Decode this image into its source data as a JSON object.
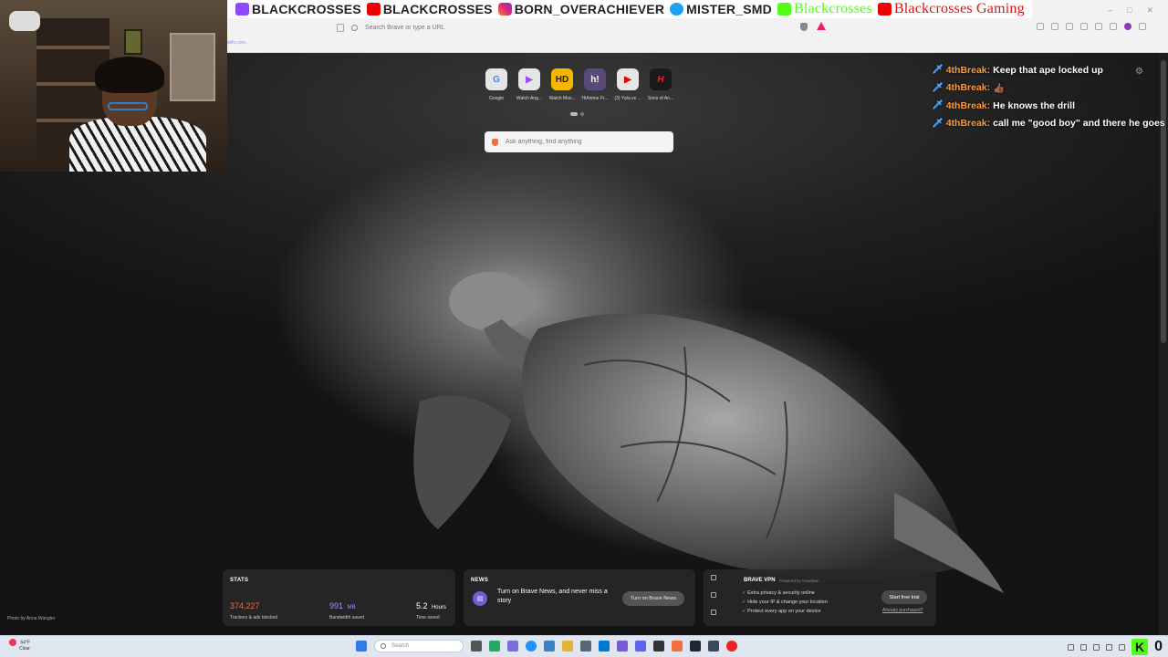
{
  "social": [
    {
      "platform": "twitch",
      "handle": "BLACKCROSSES"
    },
    {
      "platform": "youtube",
      "handle": "BLACKCROSSES"
    },
    {
      "platform": "instagram",
      "handle": "BORN_OVERACHIEVER"
    },
    {
      "platform": "twitter",
      "handle": "MISTER_SMD"
    },
    {
      "platform": "kick",
      "handle": "Blackcrosses"
    },
    {
      "platform": "youtube",
      "handle": "Blackcrosses Gaming"
    }
  ],
  "browser": {
    "address_placeholder": "Search Brave or type a URL",
    "tab_hint": "skfs.com..."
  },
  "quick_links": [
    {
      "icon": "google-icon",
      "caption": "Google",
      "color": "#e6e6e6"
    },
    {
      "icon": "play-icon",
      "caption": "Watch Ang...",
      "color": "#e6e6e6"
    },
    {
      "icon": "hd-icon",
      "caption": "Watch Mov...",
      "label": "HD",
      "color": "#f5b700"
    },
    {
      "icon": "hianime-icon",
      "caption": "HiAnime Fr...",
      "label": "h!",
      "color": "#5a4a7a"
    },
    {
      "icon": "youtube-icon",
      "caption": "(3) Yuta vs ...",
      "color": "#e6e6e6"
    },
    {
      "icon": "h-icon",
      "caption": "Sons of An...",
      "label": "H",
      "color": "#1a1a1a"
    }
  ],
  "search": {
    "placeholder": "Ask anything, find anything"
  },
  "chat": [
    {
      "user": "4thBreak:",
      "text": "Keep that ape locked up"
    },
    {
      "user": "4thBreak:",
      "text": "👍🏾"
    },
    {
      "user": "4thBreak:",
      "text": "He knows the drill"
    },
    {
      "user": "4thBreak:",
      "text": "call me \"good boy\" and there he goes"
    }
  ],
  "stats": {
    "label": "STATS",
    "trackers": {
      "value": "374,227",
      "sub": "Trackers & ads blocked"
    },
    "bandwidth": {
      "value": "991",
      "unit": "MB",
      "sub": "Bandwidth saved"
    },
    "time": {
      "value": "5.2",
      "unit": "Hours",
      "sub": "Time saved"
    }
  },
  "news": {
    "label": "NEWS",
    "text": "Turn on Brave News, and never miss a story",
    "button": "Turn on Brave News"
  },
  "vpn": {
    "title": "BRAVE VPN",
    "powered": "Powered by Guardian",
    "features": [
      "Extra privacy & security online",
      "Hide your IP & change your location",
      "Protect every app on your device"
    ],
    "button": "Start free trial",
    "link": "Already purchased?"
  },
  "photo_credit": "Photo by Anna Wangler",
  "weather": {
    "temp": "64°F",
    "cond": "Clear"
  },
  "taskbar": {
    "search_placeholder": "Search"
  },
  "overlay_counter": "0",
  "colors": {
    "chat_user": "#ff9a3c",
    "accent_orange": "#f36e3b",
    "kick_green": "#53fc18",
    "stats_tracker": "#f36e3b",
    "stats_bandwidth": "#a98bff"
  }
}
